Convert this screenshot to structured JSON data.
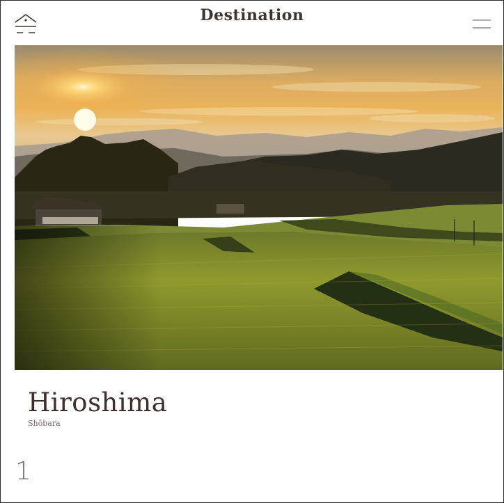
{
  "header": {
    "title": "Destination",
    "home_icon": "house-roof-icon",
    "menu_icon": "hamburger-menu-icon"
  },
  "hero": {
    "image": "sunset-over-rice-terraces-photo"
  },
  "caption": {
    "city": "Hiroshima",
    "subtitle": "Shōbara"
  },
  "pagination": {
    "current": "1"
  },
  "colors": {
    "title_text": "#3d3530",
    "city_text": "#3d2f2d",
    "sky_gold": "#e8a94a",
    "field_green": "#8f9a2e"
  }
}
